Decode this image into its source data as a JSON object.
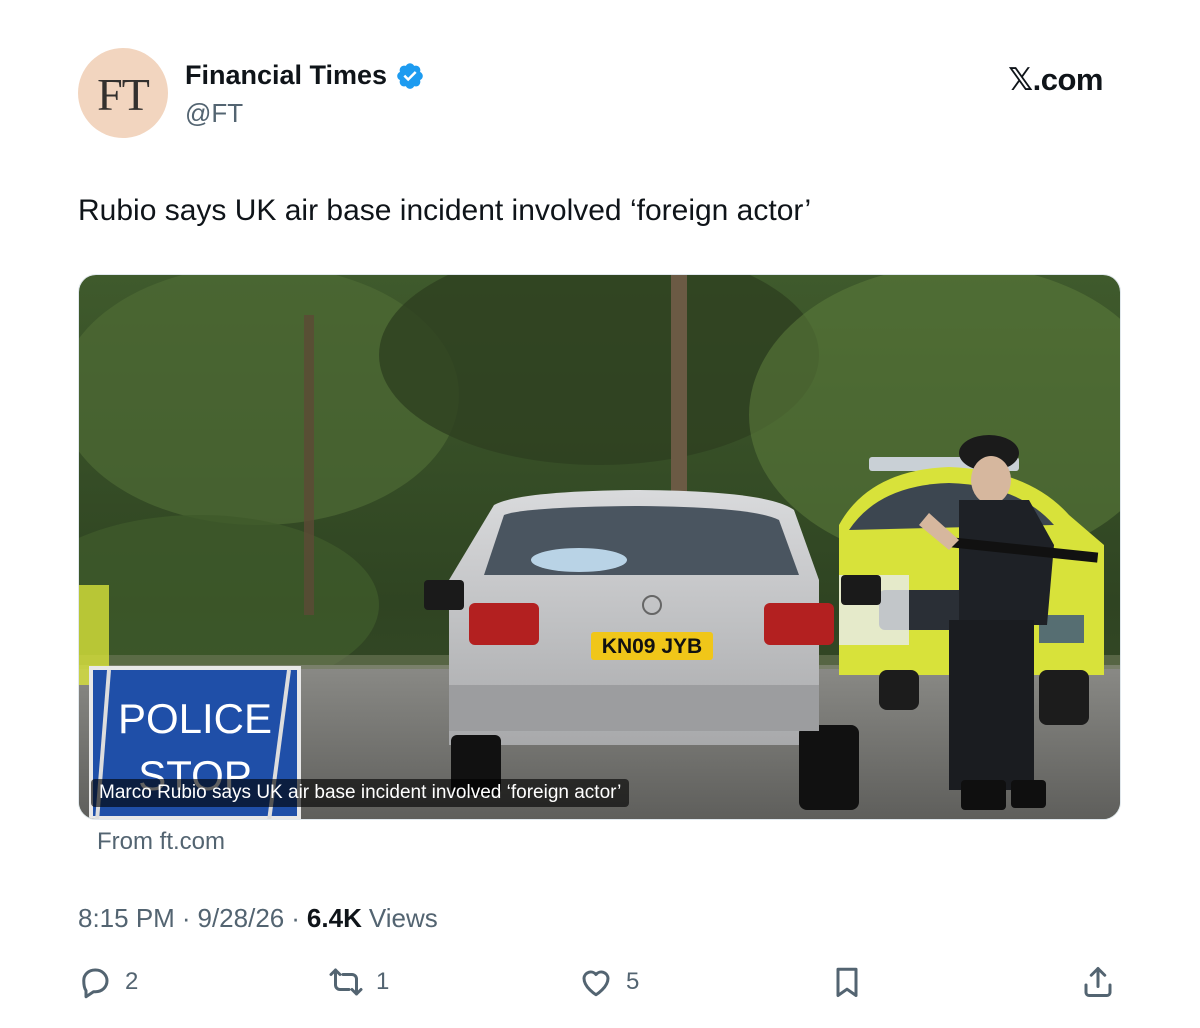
{
  "account": {
    "avatar_text": "FT",
    "display_name": "Financial Times",
    "handle": "@FT",
    "verified": true
  },
  "site_logo": "𝕏.com",
  "tweet": {
    "text": "Rubio says UK air base incident involved ‘foreign actor’",
    "card": {
      "caption": "Marco Rubio says UK air base incident involved ‘foreign actor’",
      "source": "From ft.com",
      "photo": {
        "sign_line1": "POLICE",
        "sign_line2": "STOP",
        "plate": "KN09 JYB"
      }
    },
    "time": "8:15 PM",
    "date": "9/28/26",
    "views_count": "6.4K",
    "views_label": "Views",
    "separator": "·"
  },
  "actions": {
    "replies": "2",
    "reposts": "1",
    "likes": "5"
  },
  "colors": {
    "verified": "#1d9bf0",
    "muted_text": "#536471",
    "avatar_bg": "#f2d5bf"
  },
  "icons": [
    "verified-badge-icon",
    "reply-icon",
    "repost-icon",
    "like-icon",
    "bookmark-icon",
    "share-icon"
  ]
}
